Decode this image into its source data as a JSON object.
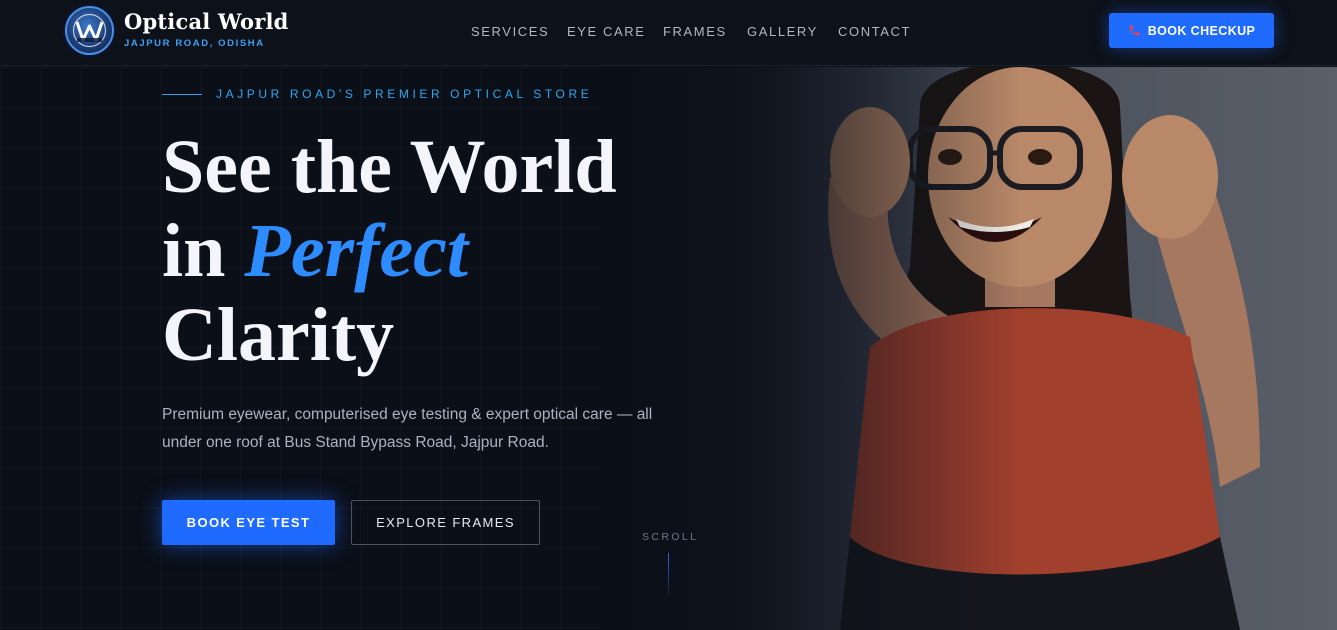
{
  "brand": {
    "name": "Optical World",
    "location": "JAJPUR ROAD, ODISHA",
    "logo_icon": "optical-world-logo"
  },
  "nav": {
    "links": [
      "SERVICES",
      "EYE CARE",
      "FRAMES",
      "GALLERY",
      "CONTACT"
    ],
    "cta_label": "BOOK CHECKUP",
    "cta_icon": "phone-icon"
  },
  "hero": {
    "tagline": "JAJPUR ROAD'S PREMIER OPTICAL STORE",
    "headline_line1": "See the World",
    "headline_line2_prefix": "in",
    "headline_accent": "Perfect",
    "headline_line3": "Clarity",
    "subtext": "Premium eyewear, computerised eye testing & expert optical care — all under one roof at Bus Stand Bypass Road, Jajpur Road.",
    "primary_button": "BOOK EYE TEST",
    "secondary_button": "EXPLORE FRAMES",
    "scroll_label": "SCROLL",
    "image": "woman-with-glasses-photo"
  },
  "colors": {
    "background": "#0b0f18",
    "accent_blue": "#1f6bff",
    "accent_cyan": "#2ea7f0",
    "text_primary": "#f3f5fa",
    "text_muted": "#aab2c3"
  }
}
